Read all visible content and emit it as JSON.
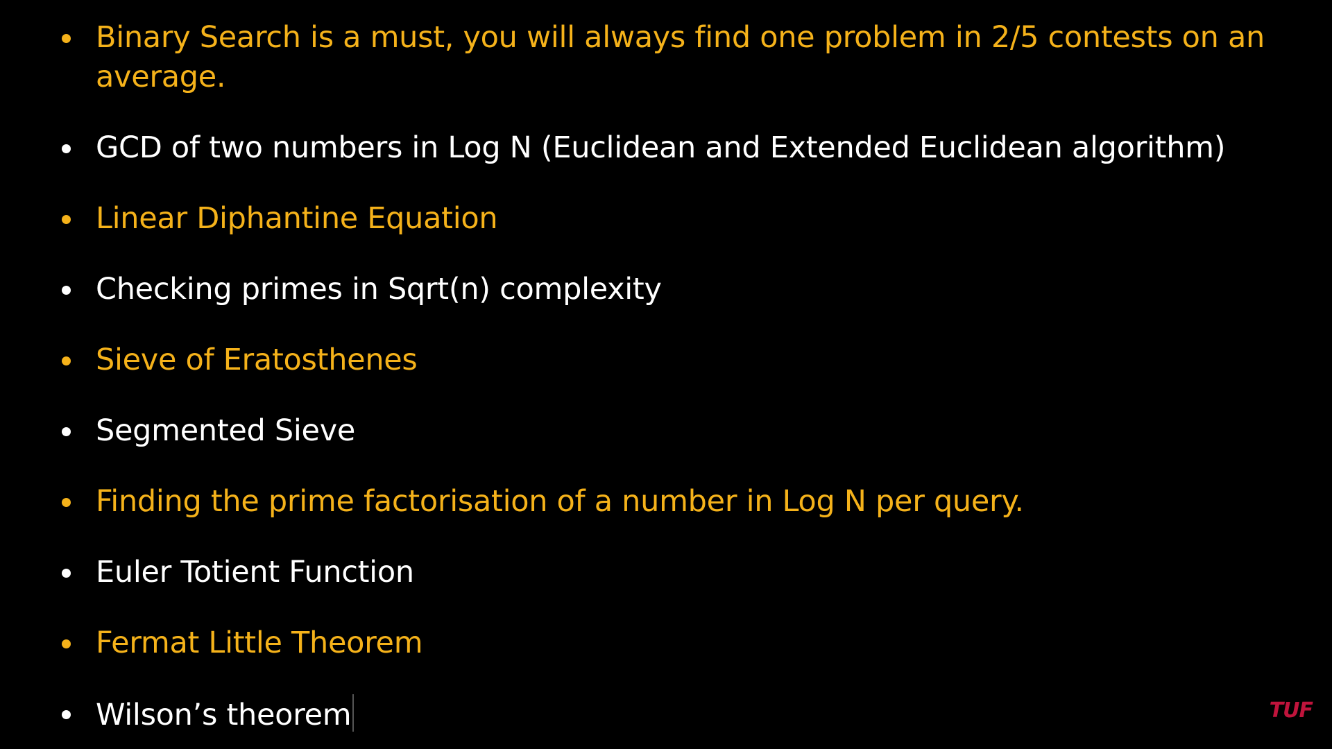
{
  "slide": {
    "items": [
      {
        "text": "Binary Search is a must, you will always find one problem in 2/5 contests on an average.",
        "color": "#f5b21a"
      },
      {
        "text": "GCD of two numbers in Log N (Euclidean and Extended Euclidean algorithm)",
        "color": "#ffffff"
      },
      {
        "text": "Linear Diphantine Equation",
        "color": "#f5b21a"
      },
      {
        "text": "Checking primes in Sqrt(n) complexity",
        "color": "#ffffff"
      },
      {
        "text": "Sieve of Eratosthenes",
        "color": "#f5b21a"
      },
      {
        "text": "Segmented Sieve",
        "color": "#ffffff"
      },
      {
        "text": "Finding the prime factorisation of a number in Log N per query.",
        "color": "#f5b21a"
      },
      {
        "text": "Euler Totient Function",
        "color": "#ffffff"
      },
      {
        "text": "Fermat Little Theorem",
        "color": "#f5b21a"
      },
      {
        "text": "Wilson’s theorem",
        "color": "#ffffff"
      }
    ]
  },
  "watermark": {
    "logo_text": "TUF",
    "color": "#c0143c"
  },
  "colors": {
    "background": "#000000",
    "accent": "#f5b21a",
    "text": "#ffffff"
  }
}
